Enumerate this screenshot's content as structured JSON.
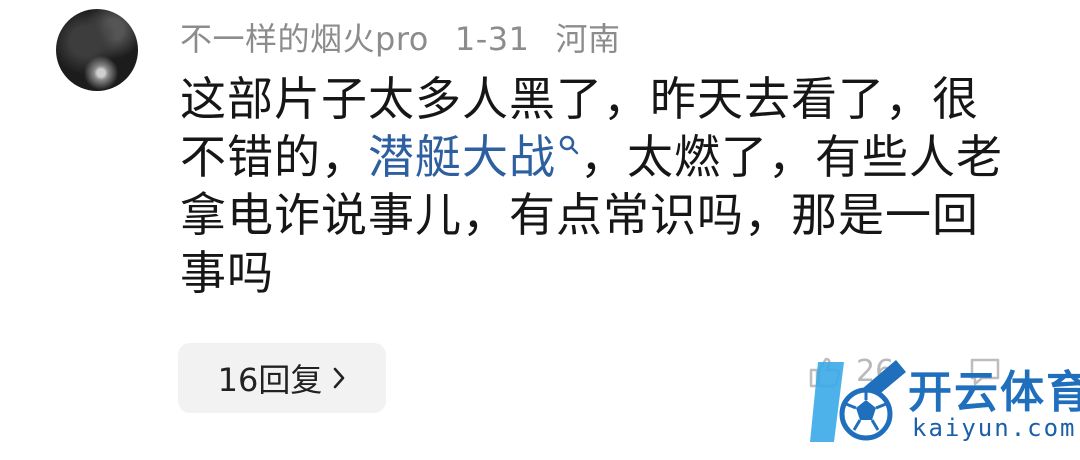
{
  "comment": {
    "username": "不一样的烟火pro",
    "date": "1-31",
    "location": "河南",
    "text_before_link": "这部片子太多人黑了，昨天去看了，很不错的，",
    "link_text": "潜艇大战",
    "text_after_link": "，太燃了，有些人老拿电诈说事儿，有点常识吗，那是一回事吗",
    "reply_label": "16回复",
    "like_count": "26"
  },
  "watermark": {
    "brand": "开云体育",
    "url": "kaiyun.com"
  },
  "colors": {
    "link": "#2e5f9e",
    "meta": "#8c8c8c",
    "watermark": "#1f6fbd"
  },
  "icons": [
    "search-icon",
    "chevron-right-icon",
    "like-icon",
    "comment-icon",
    "kaiyun-logo-icon"
  ]
}
